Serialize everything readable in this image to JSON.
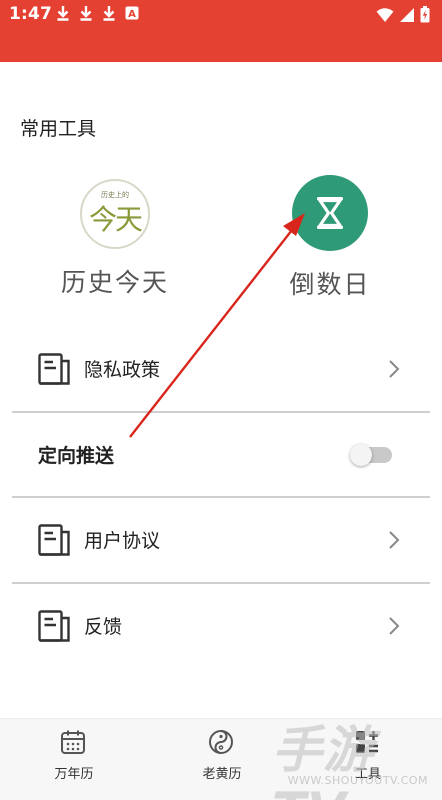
{
  "status_bar": {
    "time": "1:47",
    "left_icons": [
      "download-icon",
      "download-icon",
      "download-icon",
      "a-badge-icon"
    ],
    "right_icons": [
      "wifi-icon",
      "signal-icon",
      "battery-charging-icon"
    ],
    "a_badge": "A",
    "color": "#e54133"
  },
  "section": {
    "title": "常用工具"
  },
  "tools": [
    {
      "label": "历史今天",
      "icon": "history-today-icon",
      "icon_small_text": "历史上的",
      "icon_big_text": "今天"
    },
    {
      "label": "倒数日",
      "icon": "hourglass-icon",
      "color": "#2f9a77"
    }
  ],
  "settings": [
    {
      "label": "隐私政策",
      "icon": "document-icon",
      "trailing": "chevron-right-icon"
    },
    {
      "label": "定向推送",
      "trailing": "toggle",
      "enabled": false
    },
    {
      "label": "用户协议",
      "icon": "document-icon",
      "trailing": "chevron-right-icon"
    },
    {
      "label": "反馈",
      "icon": "document-icon",
      "trailing": "chevron-right-icon"
    }
  ],
  "annotation": {
    "type": "arrow",
    "color": "#d9261c"
  },
  "tabbar": {
    "tabs": [
      {
        "label": "万年历",
        "icon": "calendar-icon"
      },
      {
        "label": "老黄历",
        "icon": "yin-yang-icon"
      },
      {
        "label": "工具",
        "icon": "tools-grid-icon",
        "active": true
      }
    ]
  },
  "watermark": {
    "main": "手游TV",
    "url": "WWW.SHOUYOUTV.COM"
  }
}
